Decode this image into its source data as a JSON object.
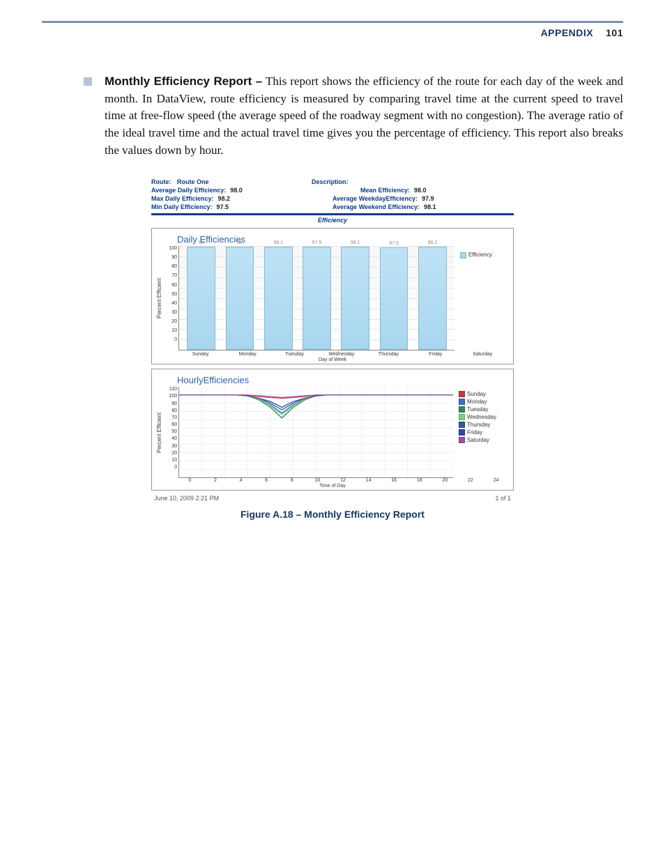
{
  "header": {
    "section": "APPENDIX",
    "page": "101"
  },
  "body": {
    "lead": "Monthly Efficiency Report –",
    "text": " This report shows the efficiency of the route for each day of the week and month. In DataView, route efficiency is measured by comparing travel time at the current speed to travel time at free-flow speed (the average speed of the roadway segment with no congestion). The average ratio of the ideal travel time and the actual travel time gives you the percentage of efficiency. This report also breaks the values down by hour."
  },
  "report": {
    "route_label": "Route:",
    "route_value": "Route One",
    "desc_label": "Description:",
    "avg_daily_label": "Average Daily Efficiency:",
    "avg_daily_value": "98.0",
    "mean_label": "Mean Efficiency:",
    "mean_value": "98.0",
    "max_label": "Max Daily Efficiency:",
    "max_value": "98.2",
    "avg_wkday_label": "Average WeekdayEfficiency:",
    "avg_wkday_value": "97.9",
    "min_label": "Min Daily Efficiency:",
    "min_value": "97.5",
    "avg_wkend_label": "Average Weekend Efficiency:",
    "avg_wkend_value": "98.1",
    "eff_title": "Efficiency",
    "footer_date": "June 10, 2009 2:21 PM",
    "footer_page": "1 of 1"
  },
  "chart_data": [
    {
      "type": "bar",
      "title": "Daily Efficiencies",
      "ylabel": "Percent Efficient",
      "xlabel": "Day of Week",
      "ylim": [
        0,
        100
      ],
      "yticks": [
        100,
        90,
        80,
        70,
        60,
        50,
        40,
        30,
        20,
        10,
        0
      ],
      "categories": [
        "Sunday",
        "Monday",
        "Tuesday",
        "Wednesday",
        "Thursday",
        "Friday",
        "Saturday"
      ],
      "values": [
        98,
        98,
        98.1,
        97.9,
        98.1,
        97.5,
        98.2
      ],
      "legend": [
        "Efficiency"
      ]
    },
    {
      "type": "line",
      "title": "HourlyEfficiencies",
      "ylabel": "Percent Efficient",
      "xlabel": "Time of Day",
      "ylim": [
        0,
        110
      ],
      "yticks": [
        110,
        100,
        90,
        80,
        70,
        60,
        50,
        40,
        30,
        20,
        10,
        0
      ],
      "xticks": [
        0,
        2,
        4,
        6,
        8,
        10,
        12,
        14,
        16,
        18,
        20,
        22,
        24
      ],
      "series": [
        {
          "name": "Sunday",
          "color": "#c23a3a",
          "values": [
            100,
            100,
            100,
            100,
            100,
            100,
            100,
            98,
            97,
            96,
            97,
            98,
            100,
            100,
            100,
            100,
            100,
            100,
            100,
            100,
            100,
            100,
            100,
            100,
            100
          ]
        },
        {
          "name": "Monday",
          "color": "#3a6fc2",
          "values": [
            100,
            100,
            100,
            100,
            100,
            100,
            99,
            95,
            88,
            78,
            88,
            95,
            99,
            100,
            100,
            100,
            100,
            100,
            100,
            100,
            100,
            100,
            100,
            100,
            100
          ]
        },
        {
          "name": "Tuesday",
          "color": "#2e8a66",
          "values": [
            100,
            100,
            100,
            100,
            100,
            100,
            99,
            94,
            85,
            72,
            85,
            94,
            99,
            100,
            100,
            100,
            100,
            100,
            100,
            100,
            100,
            100,
            100,
            100,
            100
          ]
        },
        {
          "name": "Wednesday",
          "color": "#7fd07f",
          "values": [
            100,
            100,
            100,
            100,
            100,
            100,
            99,
            95,
            87,
            76,
            87,
            95,
            99,
            100,
            100,
            100,
            100,
            100,
            100,
            100,
            100,
            100,
            100,
            100,
            100
          ]
        },
        {
          "name": "Thursday",
          "color": "#2b5f8f",
          "values": [
            100,
            100,
            100,
            100,
            100,
            100,
            99,
            96,
            90,
            82,
            90,
            96,
            99,
            100,
            100,
            100,
            100,
            100,
            100,
            100,
            100,
            100,
            100,
            100,
            100
          ]
        },
        {
          "name": "Friday",
          "color": "#3743a6",
          "values": [
            100,
            100,
            100,
            100,
            100,
            100,
            99,
            96,
            92,
            85,
            92,
            96,
            99,
            100,
            100,
            100,
            100,
            100,
            100,
            100,
            100,
            100,
            100,
            100,
            100
          ]
        },
        {
          "name": "Saturday",
          "color": "#a34fa3",
          "values": [
            100,
            100,
            100,
            100,
            100,
            100,
            100,
            99,
            98,
            97,
            98,
            99,
            100,
            100,
            100,
            100,
            100,
            100,
            100,
            100,
            100,
            100,
            100,
            100,
            100
          ]
        }
      ]
    }
  ],
  "caption": "Figure A.18 – Monthly Efficiency Report"
}
